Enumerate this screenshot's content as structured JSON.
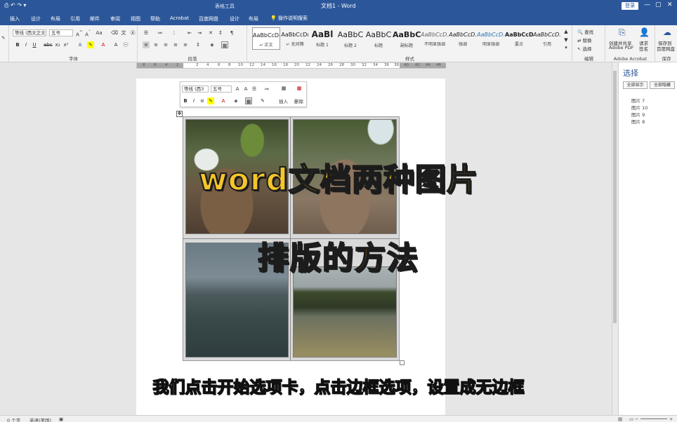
{
  "titlebar": {
    "qat_icons": "⎙  ↶  ↷  ▾",
    "context_label": "表格工具",
    "doc_title": "文档1 - Word",
    "login_label": "登录",
    "min": "—",
    "max": "▢",
    "close": "✕"
  },
  "tabs": [
    "插入",
    "设计",
    "布局",
    "引用",
    "邮件",
    "审阅",
    "视图",
    "帮助",
    "Acrobat",
    "百度网盘",
    "设计",
    "布局"
  ],
  "tellme": "操作说明搜索",
  "ribbon": {
    "font_name": "等线 (西文正文",
    "font_size": "五号",
    "group_font": "字体",
    "group_paragraph": "段落",
    "group_styles": "样式",
    "group_edit": "编辑",
    "group_adobe": "Adobe Acrobat",
    "group_save": "保存",
    "styles": [
      {
        "sample": "AaBbCcDı",
        "name": "↵ 正文"
      },
      {
        "sample": "AaBbCcDı",
        "name": "↵ 无间隔"
      },
      {
        "sample": "AaBl",
        "name": "标题 1"
      },
      {
        "sample": "AaBbC",
        "name": "标题 2"
      },
      {
        "sample": "AaBbC",
        "name": "标题"
      },
      {
        "sample": "AaBbC",
        "name": "副标题"
      },
      {
        "sample": "AaBbCcD.",
        "name": "不明显强调"
      },
      {
        "sample": "AaBbCcD.",
        "name": "强调"
      },
      {
        "sample": "AaBbCcD.",
        "name": "明显强调"
      },
      {
        "sample": "AaBbCcD",
        "name": "要点"
      },
      {
        "sample": "AaBbCcD.",
        "name": "引用"
      }
    ],
    "edit_find": "查找",
    "edit_replace": "替换",
    "edit_select": "选择",
    "adobe_create": "创建并共享",
    "adobe_create2": "Adobe PDF",
    "adobe_request": "请求",
    "adobe_request2": "签名",
    "save_to": "保存到",
    "save_to2": "百度网盘"
  },
  "ruler_numbers": [
    "8",
    "6",
    "4",
    "2",
    "2",
    "4",
    "6",
    "8",
    "10",
    "12",
    "14",
    "16",
    "18",
    "20",
    "22",
    "24",
    "26",
    "28",
    "30",
    "32",
    "34",
    "36",
    "38",
    "40",
    "42",
    "44",
    "46"
  ],
  "mini_toolbar": {
    "font_name": "等线 (西3",
    "font_size": "五号",
    "insert_label": "插入",
    "delete_label": "删除"
  },
  "overlay": {
    "line1": "word文档两种图片",
    "line2": "排版的方法",
    "subtitle": "我们点击开始选项卡，点击边框选项，设置成无边框"
  },
  "pane": {
    "title": "选择",
    "show_all": "全部显示",
    "hide_all": "全部隐藏",
    "items": [
      "图片 7",
      "图片 10",
      "图片 9",
      "图片 8"
    ]
  },
  "statusbar": {
    "word_count": "0 个字",
    "language": "英语(美国)",
    "zoom_minus": "−",
    "zoom_plus": "+"
  }
}
